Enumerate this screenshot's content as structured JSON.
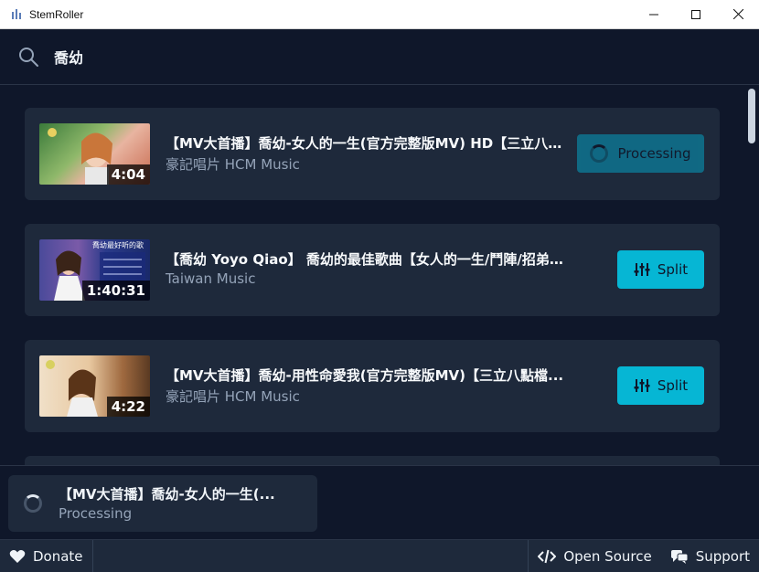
{
  "window": {
    "title": "StemRoller"
  },
  "search": {
    "value": "喬幼"
  },
  "results": [
    {
      "title": "【MV大首播】喬幼-女人的一生(官方完整版MV) HD【三立八點檔『...",
      "channel": "豪記唱片 HCM Music",
      "duration": "4:04",
      "action": "Processing"
    },
    {
      "title": "【喬幼 Yoyo Qiao】 喬幼的最佳歌曲【女人的一生/鬥陣/招弟/...",
      "channel": "Taiwan Music",
      "duration": "1:40:31",
      "action": "Split",
      "thumb_text": "喬幼最好听的歌"
    },
    {
      "title": "【MV大首播】喬幼-用性命愛我(官方完整版MV)【三立八點檔...",
      "channel": "豪記唱片 HCM Music",
      "duration": "4:22",
      "action": "Split"
    }
  ],
  "queue": {
    "title": "【MV大首播】喬幼-女人的一生(...",
    "status": "Processing"
  },
  "footer": {
    "donate": "Donate",
    "open_source": "Open Source",
    "support": "Support"
  },
  "colors": {
    "background": "#0f172a",
    "card": "#1e293b",
    "accent": "#06b6d4",
    "accent_dim": "#0e7490",
    "muted_text": "#94a3b8"
  }
}
